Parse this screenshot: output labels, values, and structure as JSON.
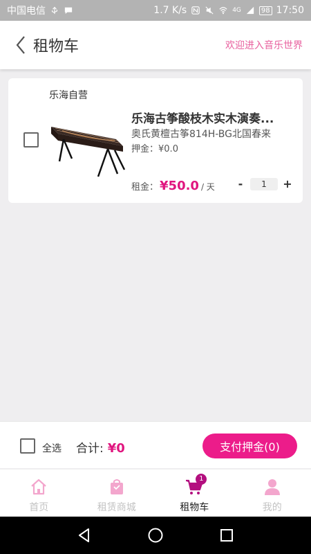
{
  "status_bar": {
    "carrier": "中国电信",
    "speed": "1.7 K/s",
    "network": "4G",
    "battery": "98",
    "time": "17:50"
  },
  "header": {
    "title": "租物车",
    "welcome": "欢迎进入音乐世界"
  },
  "cart": {
    "store_name": "乐海自营",
    "items": [
      {
        "name": "乐海古筝酸枝木实木演奏...",
        "subtitle": "奥氏黄檀古筝814H-BG北国春来",
        "deposit_label": "押金：",
        "deposit_value": "¥0.0",
        "rent_label": "租金：",
        "rent_price": "¥50.0",
        "rent_unit": "/ 天",
        "quantity": "1",
        "minus": "-",
        "plus": "+"
      }
    ]
  },
  "action_bar": {
    "select_all": "全选",
    "total_label": "合计:",
    "total_value": "¥0",
    "pay_button": "支付押金(0)"
  },
  "tabs": [
    {
      "label": "首页",
      "icon": "home-icon"
    },
    {
      "label": "租赁商城",
      "icon": "shopping-bag-icon"
    },
    {
      "label": "租物车",
      "icon": "cart-icon",
      "badge": "1",
      "active": true
    },
    {
      "label": "我的",
      "icon": "user-icon"
    }
  ],
  "colors": {
    "accent": "#ec1c8a",
    "price": "#e0167f",
    "welcome": "#e8609e",
    "tab_inactive_icon": "#f3a6cd"
  }
}
